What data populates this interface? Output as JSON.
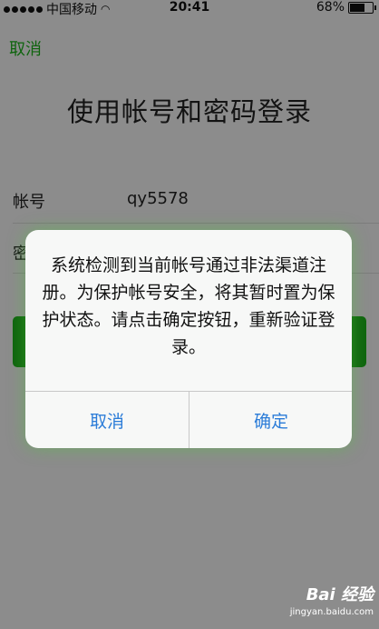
{
  "status_bar": {
    "carrier": "中国移动",
    "wifi_icon": "wifi-icon",
    "time": "20:41",
    "battery_percent_text": "68%",
    "battery_level": 0.68
  },
  "login": {
    "cancel_label": "取消",
    "title": "使用帐号和密码登录",
    "account_label": "帐号",
    "account_value": "qy5578",
    "password_label_partial": "密",
    "accent_color": "#1aad19"
  },
  "alert": {
    "message": "系统检测到当前帐号通过非法渠道注册。为保护帐号安全，将其暂时置为保护状态。请点击确定按钮，重新验证登录。",
    "cancel_label": "取消",
    "confirm_label": "确定",
    "button_color": "#2b7cd8"
  },
  "watermark": {
    "logo": "Bai  经验",
    "url": "jingyan.baidu.com"
  }
}
